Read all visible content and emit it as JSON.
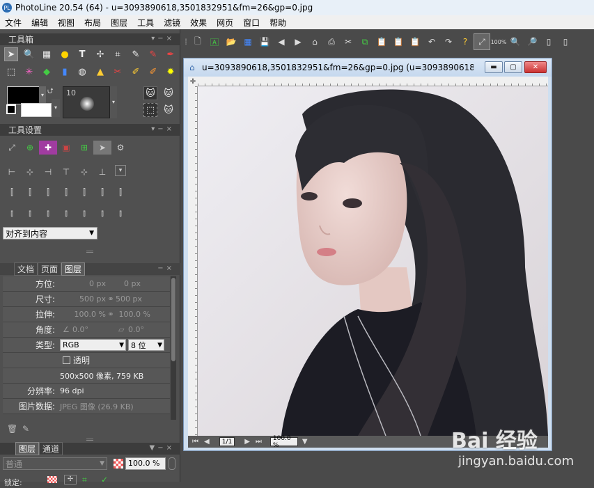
{
  "window": {
    "title": "PhotoLine 20.54 (64) - u=3093890618,3501832951&fm=26&gp=0.jpg",
    "app_icon_text": "PL"
  },
  "menu": [
    "文件",
    "编辑",
    "视图",
    "布局",
    "图层",
    "工具",
    "滤镜",
    "效果",
    "网页",
    "窗口",
    "帮助"
  ],
  "toolbox": {
    "title": "工具箱",
    "brush_size": "10"
  },
  "tool_settings": {
    "title": "工具设置",
    "align_dropdown": "对齐到内容"
  },
  "props": {
    "tabs": [
      "文档",
      "页面",
      "图层"
    ],
    "rows": [
      {
        "label": "方位:",
        "v1": "0 px",
        "v2": "0 px"
      },
      {
        "label": "尺寸:",
        "v1": "500 px",
        "v2": "500 px"
      },
      {
        "label": "拉伸:",
        "v1": "100.0 %",
        "v2": "100.0 %"
      },
      {
        "label": "角度:",
        "v1": "0.0°",
        "v2": "0.0°"
      }
    ],
    "type_label": "类型:",
    "type_value": "RGB",
    "bits_value": "8 位",
    "transparent_label": "透明",
    "info": "500x500 像素, 759 KB",
    "resolution_label": "分辨率:",
    "resolution_value": "96 dpi",
    "imgdata_label": "图片数据:",
    "imgdata_value": "JPEG 图像 (26.9 KB)"
  },
  "layers_panel": {
    "tabs": [
      "图层",
      "通道"
    ],
    "blend_mode": "普通",
    "opacity": "100.0 %",
    "lock_label": "锁定:"
  },
  "document": {
    "title": "u=3093890618,3501832951&fm=26&gp=0.jpg (u=3093890618,35...",
    "page_indicator": "1/1",
    "zoom": "100.0 %"
  },
  "toolbar": {
    "zoom_label": "100%"
  },
  "watermark": {
    "brand": "Bai 经验",
    "url": "jingyan.baidu.com"
  }
}
